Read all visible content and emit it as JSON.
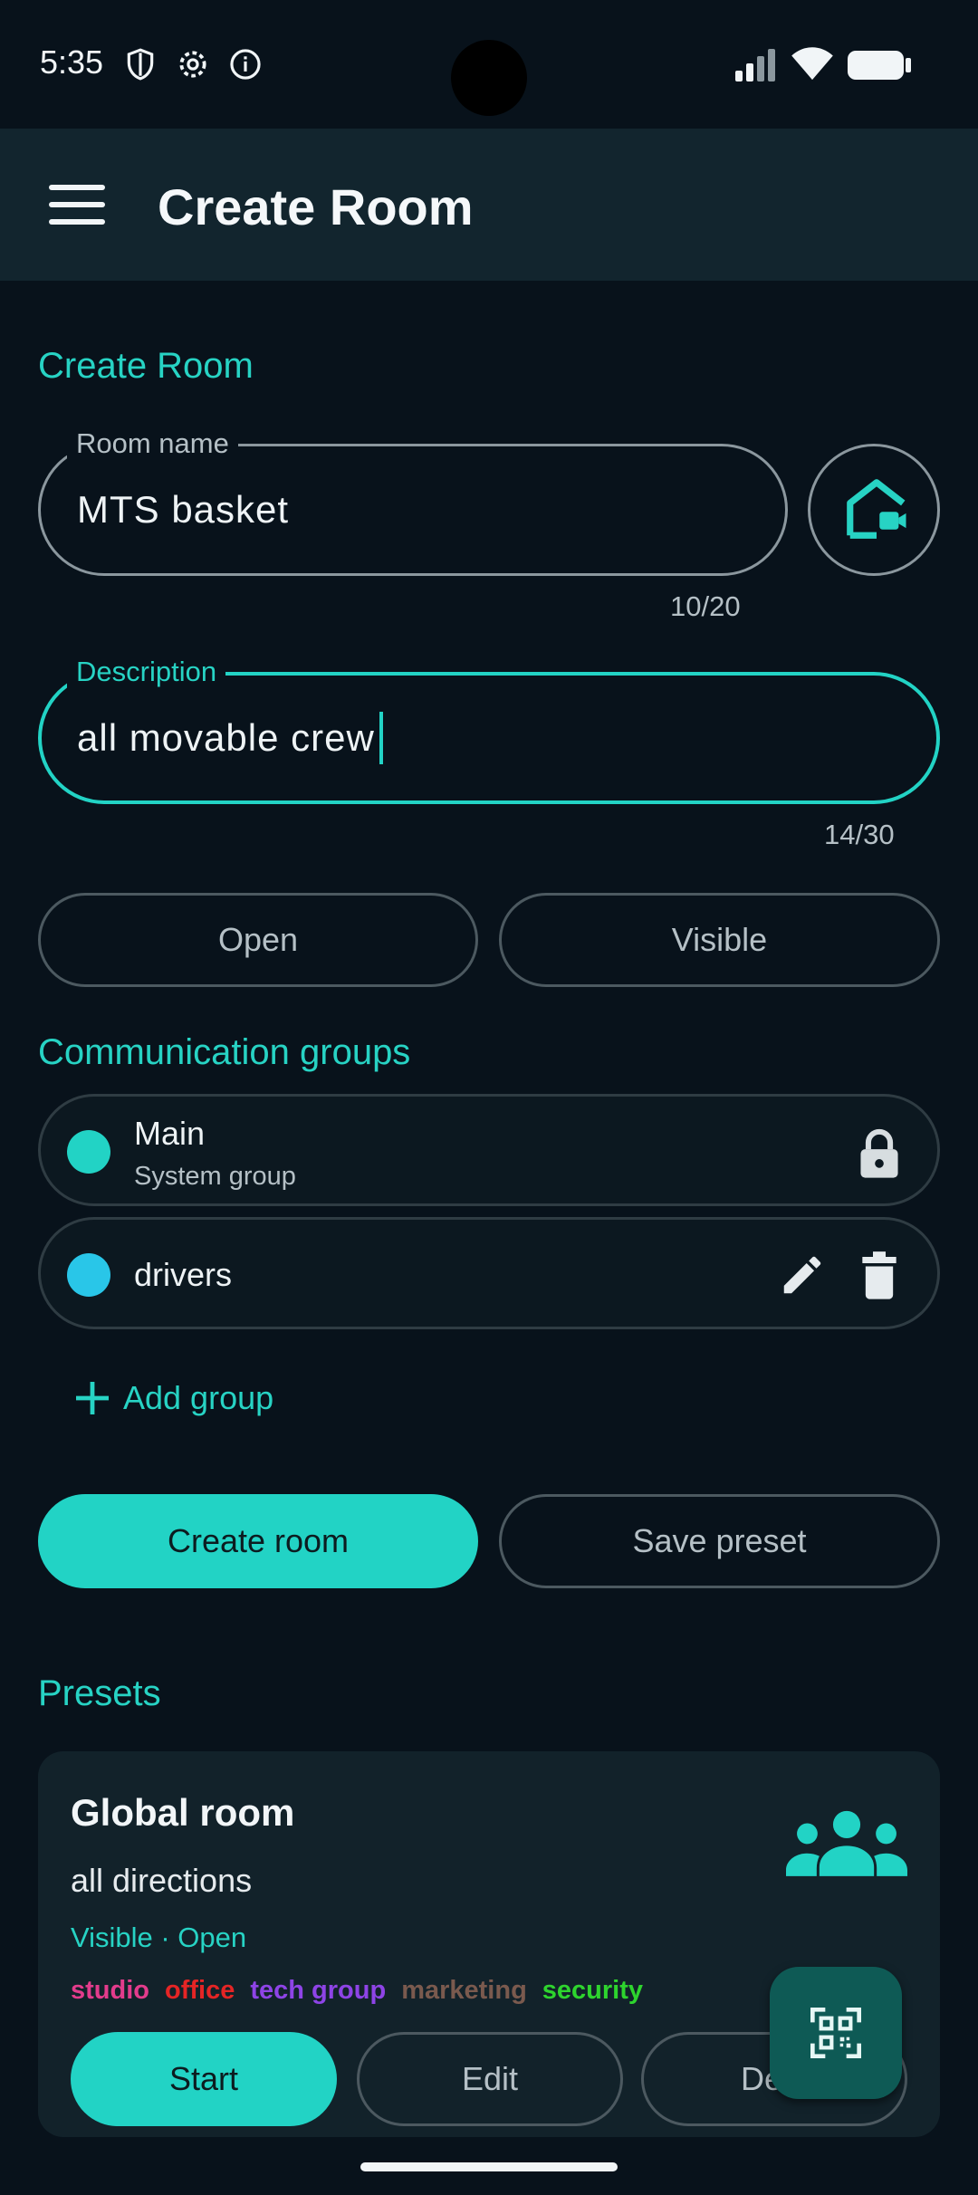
{
  "status_bar": {
    "time": "5:35",
    "left_icons": [
      "shield-icon",
      "gear-icon",
      "info-icon"
    ],
    "right_icons": [
      "signal-icon",
      "wifi-icon",
      "battery-icon"
    ]
  },
  "app_bar": {
    "title": "Create Room",
    "menu_icon": "menu-icon"
  },
  "form": {
    "section_title": "Create Room",
    "room_name": {
      "label": "Room name",
      "value": "MTS basket",
      "counter": "10/20"
    },
    "description": {
      "label": "Description",
      "value": "all movable crew",
      "counter": "14/30"
    },
    "toggles": {
      "open_label": "Open",
      "visible_label": "Visible"
    }
  },
  "groups": {
    "title": "Communication groups",
    "items": [
      {
        "name": "Main",
        "subtitle": "System group",
        "color": "#22d3c5"
      },
      {
        "name": "drivers",
        "subtitle": "",
        "color": "#29c6e8"
      }
    ],
    "add_label": "Add group"
  },
  "actions": {
    "create_label": "Create room",
    "save_label": "Save preset"
  },
  "presets": {
    "title": "Presets",
    "items": [
      {
        "name": "Global room",
        "description": "all directions",
        "meta": "Visible · Open",
        "tags": [
          {
            "label": "studio",
            "color": "#e33c8c"
          },
          {
            "label": "office",
            "color": "#e52525"
          },
          {
            "label": "tech group",
            "color": "#8e44e6"
          },
          {
            "label": "marketing",
            "color": "#7a5a4e"
          },
          {
            "label": "security",
            "color": "#2ed42e"
          }
        ],
        "start_label": "Start",
        "edit_label": "Edit",
        "delete_label": "Dele"
      }
    ]
  },
  "colors": {
    "accent": "#22d3c5",
    "background": "#08121b",
    "appbar": "#12252e"
  }
}
